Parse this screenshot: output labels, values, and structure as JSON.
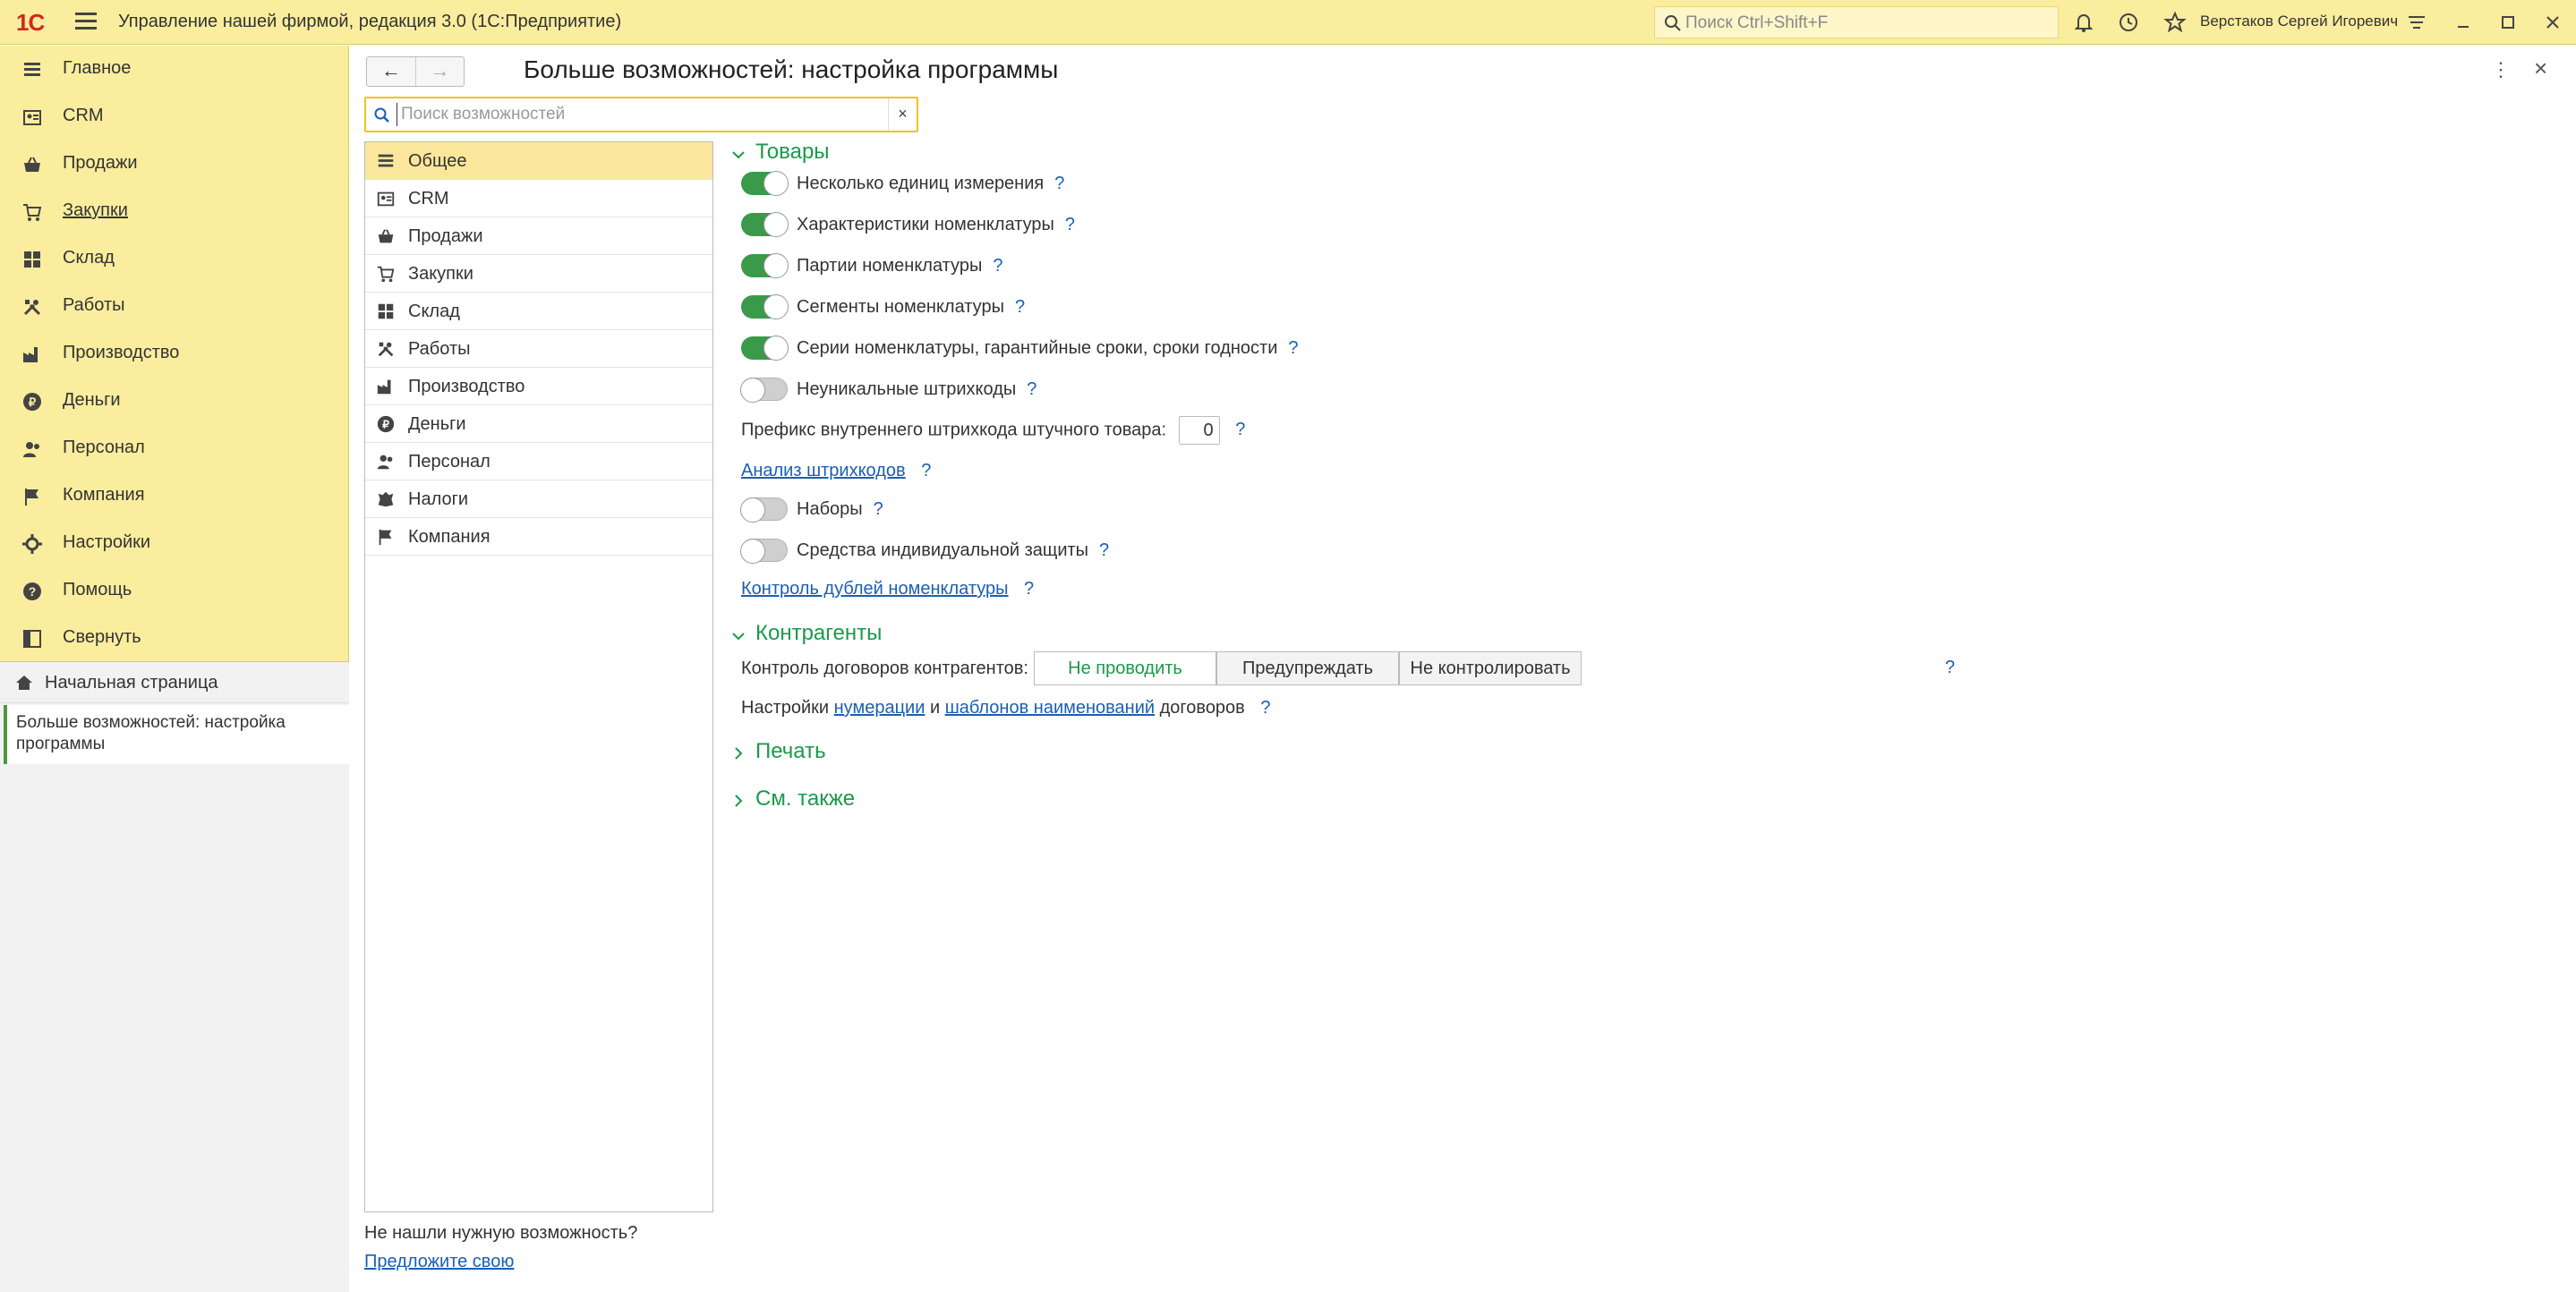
{
  "app": {
    "logo": "1С",
    "title": "Управление нашей фирмой, редакция 3.0  (1С:Предприятие)",
    "search_placeholder": "Поиск Ctrl+Shift+F",
    "user": "Верстаков Сергей Игоревич"
  },
  "sidebar": {
    "items": [
      {
        "label": "Главное",
        "icon": "list-icon"
      },
      {
        "label": "CRM",
        "icon": "crm-icon"
      },
      {
        "label": "Продажи",
        "icon": "basket-icon"
      },
      {
        "label": "Закупки",
        "icon": "cart-icon"
      },
      {
        "label": "Склад",
        "icon": "warehouse-icon"
      },
      {
        "label": "Работы",
        "icon": "tools-icon"
      },
      {
        "label": "Производство",
        "icon": "factory-icon"
      },
      {
        "label": "Деньги",
        "icon": "ruble-icon"
      },
      {
        "label": "Персонал",
        "icon": "people-icon"
      },
      {
        "label": "Компания",
        "icon": "flag-icon"
      },
      {
        "label": "Настройки",
        "icon": "gear-icon"
      },
      {
        "label": "Помощь",
        "icon": "help-icon"
      },
      {
        "label": "Свернуть",
        "icon": "collapse-icon"
      }
    ],
    "home_label": "Начальная страница",
    "current_label": "Больше возможностей: настройка программы"
  },
  "form": {
    "title": "Больше возможностей: настройка программы",
    "back": "←",
    "forward": "→",
    "more": "⋮",
    "close": "×",
    "search_placeholder": "Поиск возможностей",
    "search_value": "",
    "clear": "×",
    "sections": [
      {
        "label": "Общее",
        "icon": "list-icon",
        "active": true
      },
      {
        "label": "CRM",
        "icon": "crm-icon"
      },
      {
        "label": "Продажи",
        "icon": "basket-icon"
      },
      {
        "label": "Закупки",
        "icon": "cart-icon"
      },
      {
        "label": "Склад",
        "icon": "warehouse-icon"
      },
      {
        "label": "Работы",
        "icon": "tools-icon"
      },
      {
        "label": "Производство",
        "icon": "factory-icon"
      },
      {
        "label": "Деньги",
        "icon": "ruble-icon"
      },
      {
        "label": "Персонал",
        "icon": "people-icon"
      },
      {
        "label": "Налоги",
        "icon": "emblem-icon"
      },
      {
        "label": "Компания",
        "icon": "flag-icon"
      }
    ],
    "not_found": "Не нашли нужную возможность?",
    "suggest": "Предложите свою"
  },
  "settings": {
    "goods": {
      "title": "Товары",
      "toggles": [
        {
          "label": "Несколько единиц измерения",
          "on": true
        },
        {
          "label": "Характеристики номенклатуры",
          "on": true
        },
        {
          "label": "Партии номенклатуры",
          "on": true
        },
        {
          "label": "Сегменты номенклатуры",
          "on": true
        },
        {
          "label": "Серии номенклатуры, гарантийные сроки, сроки годности",
          "on": true
        },
        {
          "label": "Неуникальные штрихкоды",
          "on": false
        }
      ],
      "prefix_label": "Префикс внутреннего штрихкода штучного товара:",
      "prefix_value": "0",
      "barcode_analysis": "Анализ штрихкодов",
      "sets": {
        "label": "Наборы",
        "on": false
      },
      "ppe": {
        "label": "Средства индивидуальной защиты",
        "on": false
      },
      "duplicates": "Контроль дублей номенклатуры"
    },
    "counterparties": {
      "title": "Контрагенты",
      "contracts_label": "Контроль договоров контрагентов:",
      "options": [
        "Не проводить",
        "Предупреждать",
        "Не контролировать"
      ],
      "selected": "Не проводить",
      "settings_prefix": "Настройки",
      "numbering_link": "нумерации",
      "and": "и",
      "templates_link": "шаблонов наименований",
      "settings_suffix": "договоров"
    },
    "print": {
      "title": "Печать"
    },
    "see_also": {
      "title": "См. также"
    },
    "help_mark": "?"
  },
  "colors": {
    "accent_yellow": "#fbed9e",
    "active_green": "#3a9a4a",
    "group_green": "#1a9a4a",
    "link_blue": "#1a5fb4"
  }
}
